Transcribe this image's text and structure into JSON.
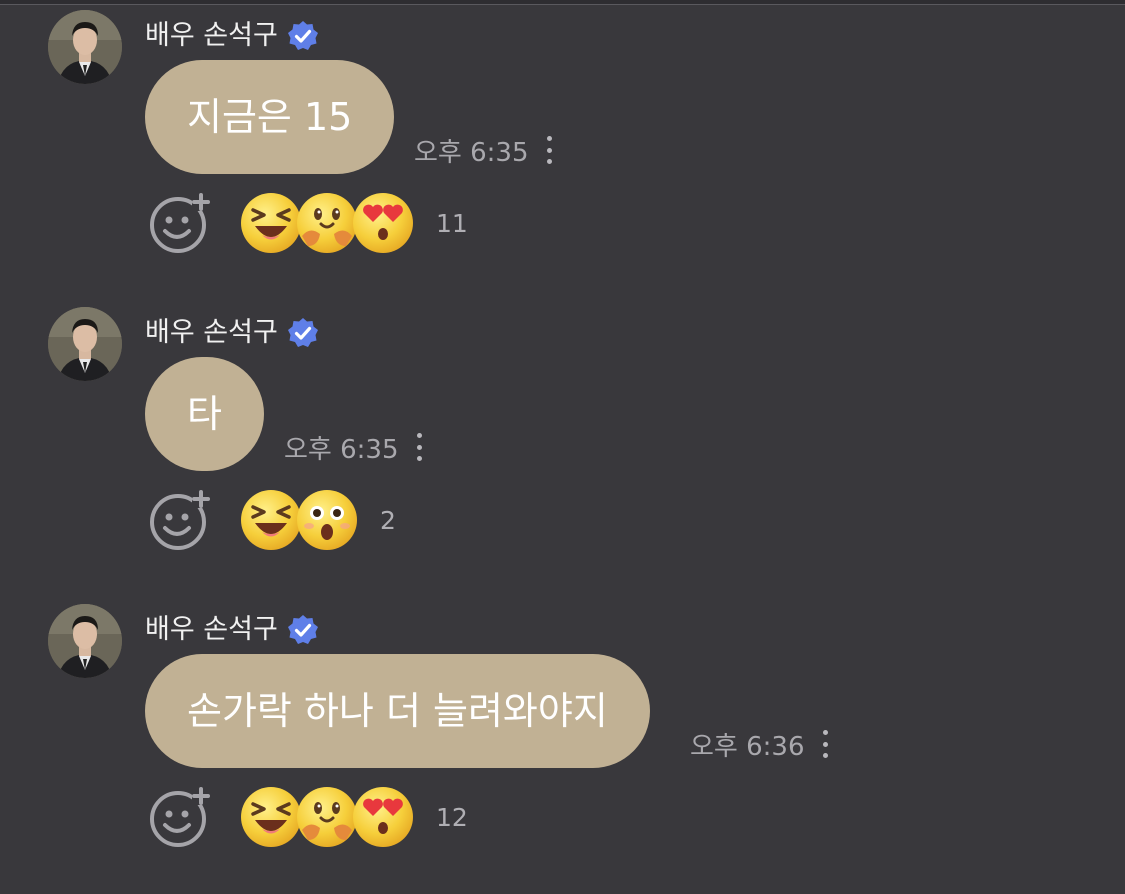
{
  "messages": [
    {
      "sender_name": "배우 손석구",
      "text": "지금은 15",
      "time": "오후 6:35",
      "reaction_count": "11",
      "reactions": [
        "laughing-emoji-icon",
        "hugging-emoji-icon",
        "heart-eyes-emoji-icon"
      ]
    },
    {
      "sender_name": "배우 손석구",
      "text": "타",
      "time": "오후 6:35",
      "reaction_count": "2",
      "reactions": [
        "laughing-emoji-icon",
        "surprised-emoji-icon"
      ]
    },
    {
      "sender_name": "배우 손석구",
      "text": "손가락 하나 더 늘려와야지",
      "time": "오후 6:36",
      "reaction_count": "12",
      "reactions": [
        "laughing-emoji-icon",
        "hugging-emoji-icon",
        "heart-eyes-emoji-icon"
      ]
    }
  ],
  "colors": {
    "background": "#39383c",
    "bubble": "#c1b194",
    "verified_badge": "#5f7fe8",
    "meta_text": "#a9a8ad"
  }
}
